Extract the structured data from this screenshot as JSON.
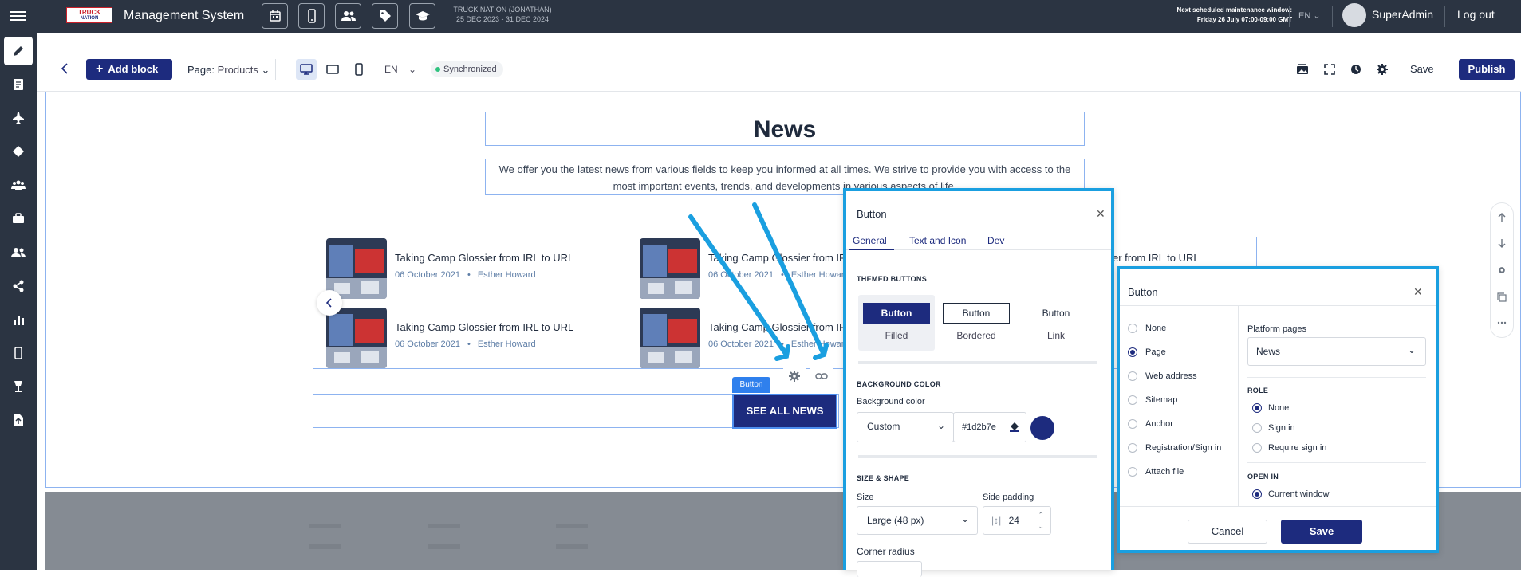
{
  "topbar": {
    "logo_line1": "TRUCK",
    "logo_line2": "NATION",
    "app_title": "Management System",
    "quick_icons": [
      "calendar-icon",
      "mobile-icon",
      "users-icon",
      "tag-icon",
      "graduation-cap-icon"
    ],
    "company_name": "TRUCK NATION (JONATHAN)",
    "company_dates": "25 DEC 2023 - 31 DEC 2024",
    "maintenance_line1": "Next scheduled maintenance window:",
    "maintenance_line2": "Friday 26 July 07:00-09:00 GMT",
    "language": "EN",
    "user_name": "SuperAdmin",
    "logout_label": "Log out"
  },
  "sidebar": {
    "icons": [
      "pencil-icon",
      "document-icon",
      "plane-icon",
      "tag-icon",
      "group-icon",
      "briefcase-icon",
      "users-icon",
      "share-icon",
      "bar-chart-icon",
      "mobile-icon",
      "lamp-icon",
      "file-upload-icon"
    ],
    "active_index": 0
  },
  "toolbar": {
    "add_block_label": "Add block",
    "page_label": "Page:",
    "page_value": "Products",
    "language": "EN",
    "sync_status": "Synchronized",
    "save_label": "Save",
    "publish_label": "Publish"
  },
  "canvas": {
    "news_title": "News",
    "news_description": "We offer you the latest news from various fields to keep you informed at all times. We strive to provide you with access to the most important events, trends, and developments in various aspects of life.",
    "news_items": [
      {
        "title": "Taking Camp Glossier from IRL to URL",
        "date": "06 October 2021",
        "author": "Esther Howard"
      },
      {
        "title": "Taking Camp Glossier from IRL to URL",
        "date": "06 October 2021",
        "author": "Esther Howard"
      },
      {
        "title": "Taking Camp Glossier from IRL to URL",
        "date": "06 October 2021",
        "author": "Esther Howard"
      },
      {
        "title": "Taking Camp Glossier from IRL to URL",
        "date": "06 October 2021",
        "author": "Esther Howard"
      }
    ],
    "partial_news_title": "er from IRL to URL",
    "date_separator": "•",
    "button_tag": "Button",
    "see_all_label": "SEE ALL NEWS"
  },
  "button_panel": {
    "title": "Button",
    "tabs": [
      "General",
      "Text and Icon",
      "Dev"
    ],
    "active_tab": 0,
    "themed_section": "THEMED BUTTONS",
    "themes": [
      {
        "preview": "Button",
        "name": "Filled"
      },
      {
        "preview": "Button",
        "name": "Bordered"
      },
      {
        "preview": "Button",
        "name": "Link"
      }
    ],
    "selected_theme": 0,
    "bg_section": "BACKGROUND COLOR",
    "bg_label": "Background color",
    "bg_mode": "Custom",
    "bg_hex": "#1d2b7e",
    "bg_color": "#1d2b7e",
    "size_section": "SIZE & SHAPE",
    "size_label": "Size",
    "size_value": "Large (48 px)",
    "padding_label": "Side padding",
    "padding_value": "24",
    "radius_label": "Corner radius"
  },
  "link_panel": {
    "title": "Button",
    "link_types": [
      "None",
      "Page",
      "Web address",
      "Sitemap",
      "Anchor",
      "Registration/Sign in",
      "Attach file"
    ],
    "selected_link_type": 1,
    "platform_label": "Platform pages",
    "platform_value": "News",
    "role_section": "ROLE",
    "roles": [
      "None",
      "Sign in",
      "Require sign in"
    ],
    "selected_role": 0,
    "open_in_section": "OPEN IN",
    "open_in_value": "Current window",
    "cancel_label": "Cancel",
    "save_label": "Save"
  },
  "colors": {
    "brand": "#1d2b7e",
    "annotation": "#1a9fe0",
    "topbar": "#2b3442",
    "selection": "#8db3f0"
  }
}
